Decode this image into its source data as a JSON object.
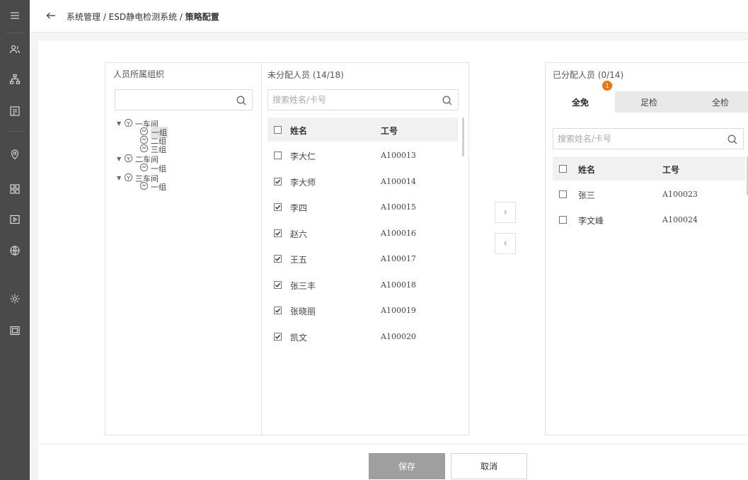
{
  "breadcrumb": "系统管理 / ESD静电检测系统 / ",
  "breadcrumb_last": "策略配置",
  "org_panel": {
    "title": "人员所属组织",
    "search_value": "",
    "tree": [
      {
        "label": "一车间",
        "level": 0,
        "expanded": true
      },
      {
        "label": "一组",
        "level": 1,
        "selected": true
      },
      {
        "label": "二组",
        "level": 1
      },
      {
        "label": "三组",
        "level": 1
      },
      {
        "label": "二车间",
        "level": 0,
        "expanded": true
      },
      {
        "label": "一组",
        "level": 1
      },
      {
        "label": "三车间",
        "level": 0,
        "expanded": true
      },
      {
        "label": "一组",
        "level": 1
      }
    ]
  },
  "unassigned": {
    "title": "未分配人员 (14/18)",
    "search_placeholder": "搜索姓名/卡号",
    "col_name": "姓名",
    "col_id": "工号",
    "rows": [
      {
        "name": "李大仁",
        "id": "A100013",
        "checked": false
      },
      {
        "name": "李大师",
        "id": "A100014",
        "checked": true
      },
      {
        "name": "李四",
        "id": "A100015",
        "checked": true
      },
      {
        "name": "赵六",
        "id": "A100016",
        "checked": true
      },
      {
        "name": "王五",
        "id": "A100017",
        "checked": true
      },
      {
        "name": "张三丰",
        "id": "A100018",
        "checked": true
      },
      {
        "name": "张晓丽",
        "id": "A100019",
        "checked": true
      },
      {
        "name": "凯文",
        "id": "A100020",
        "checked": true
      }
    ]
  },
  "transfer": {
    "right": "›",
    "left": "‹"
  },
  "assigned": {
    "title": "已分配人员 (0/14)",
    "badge": "1",
    "tabs": [
      "全免",
      "足检",
      "全检"
    ],
    "active_tab": 0,
    "search_placeholder": "搜索姓名/卡号",
    "col_name": "姓名",
    "col_id": "工号",
    "rows": [
      {
        "name": "张三",
        "id": "A100023",
        "checked": false
      },
      {
        "name": "李文峰",
        "id": "A100024",
        "checked": false
      }
    ]
  },
  "footer": {
    "save": "保存",
    "cancel": "取消"
  },
  "colors": {
    "sidebar": "#4a4a4a",
    "badge": "#e8770e",
    "save_button": "#9f9f9f"
  }
}
